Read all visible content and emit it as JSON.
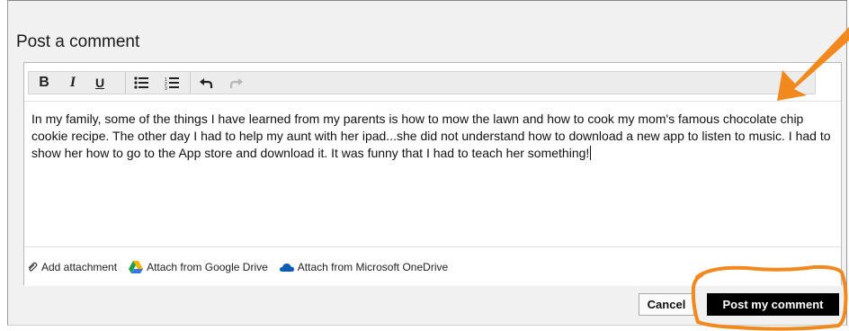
{
  "panel": {
    "title": "Post a comment"
  },
  "toolbar": {
    "bold": "B",
    "italic": "I",
    "underline": "U"
  },
  "editor": {
    "text": "In my family, some of the things I have learned from my parents is how to mow the lawn and how to cook my mom's famous chocolate chip cookie recipe. The other day I had to help my aunt with her ipad...she did not understand how to download a new app to listen to music. I had to show her how to go to the App store and download it. It was funny that I had to teach her something!"
  },
  "attachments": {
    "add": "Add attachment",
    "google_drive": "Attach from Google Drive",
    "onedrive": "Attach from Microsoft OneDrive"
  },
  "actions": {
    "cancel": "Cancel",
    "post": "Post my comment"
  },
  "colors": {
    "annotation": "#f2891e",
    "post_button": "#000000"
  }
}
